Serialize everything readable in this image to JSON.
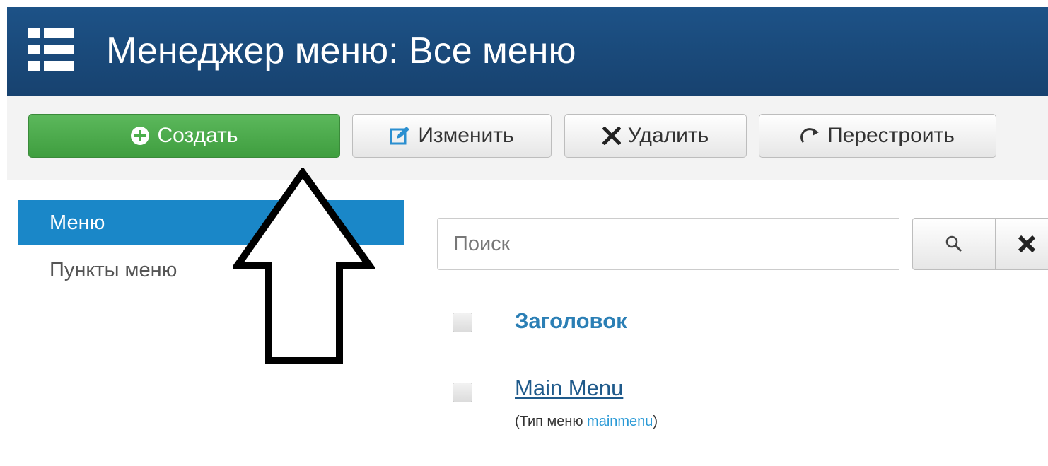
{
  "header": {
    "title": "Менеджер меню: Все меню",
    "icon": "list-icon",
    "background": "#1d5287"
  },
  "toolbar": {
    "create_label": "Создать",
    "edit_label": "Изменить",
    "delete_label": "Удалить",
    "rebuild_label": "Перестроить",
    "create_color": "#4cae4c"
  },
  "sidebar": {
    "items": [
      {
        "label": "Меню",
        "active": true
      },
      {
        "label": "Пункты меню",
        "active": false
      }
    ],
    "active_color": "#1a87c8"
  },
  "search": {
    "placeholder": "Поиск",
    "value": ""
  },
  "table": {
    "header_title": "Заголовок",
    "rows": [
      {
        "title": "Main Menu",
        "type_prefix": "(Тип меню ",
        "type_value": "mainmenu",
        "type_suffix": ")"
      }
    ]
  }
}
